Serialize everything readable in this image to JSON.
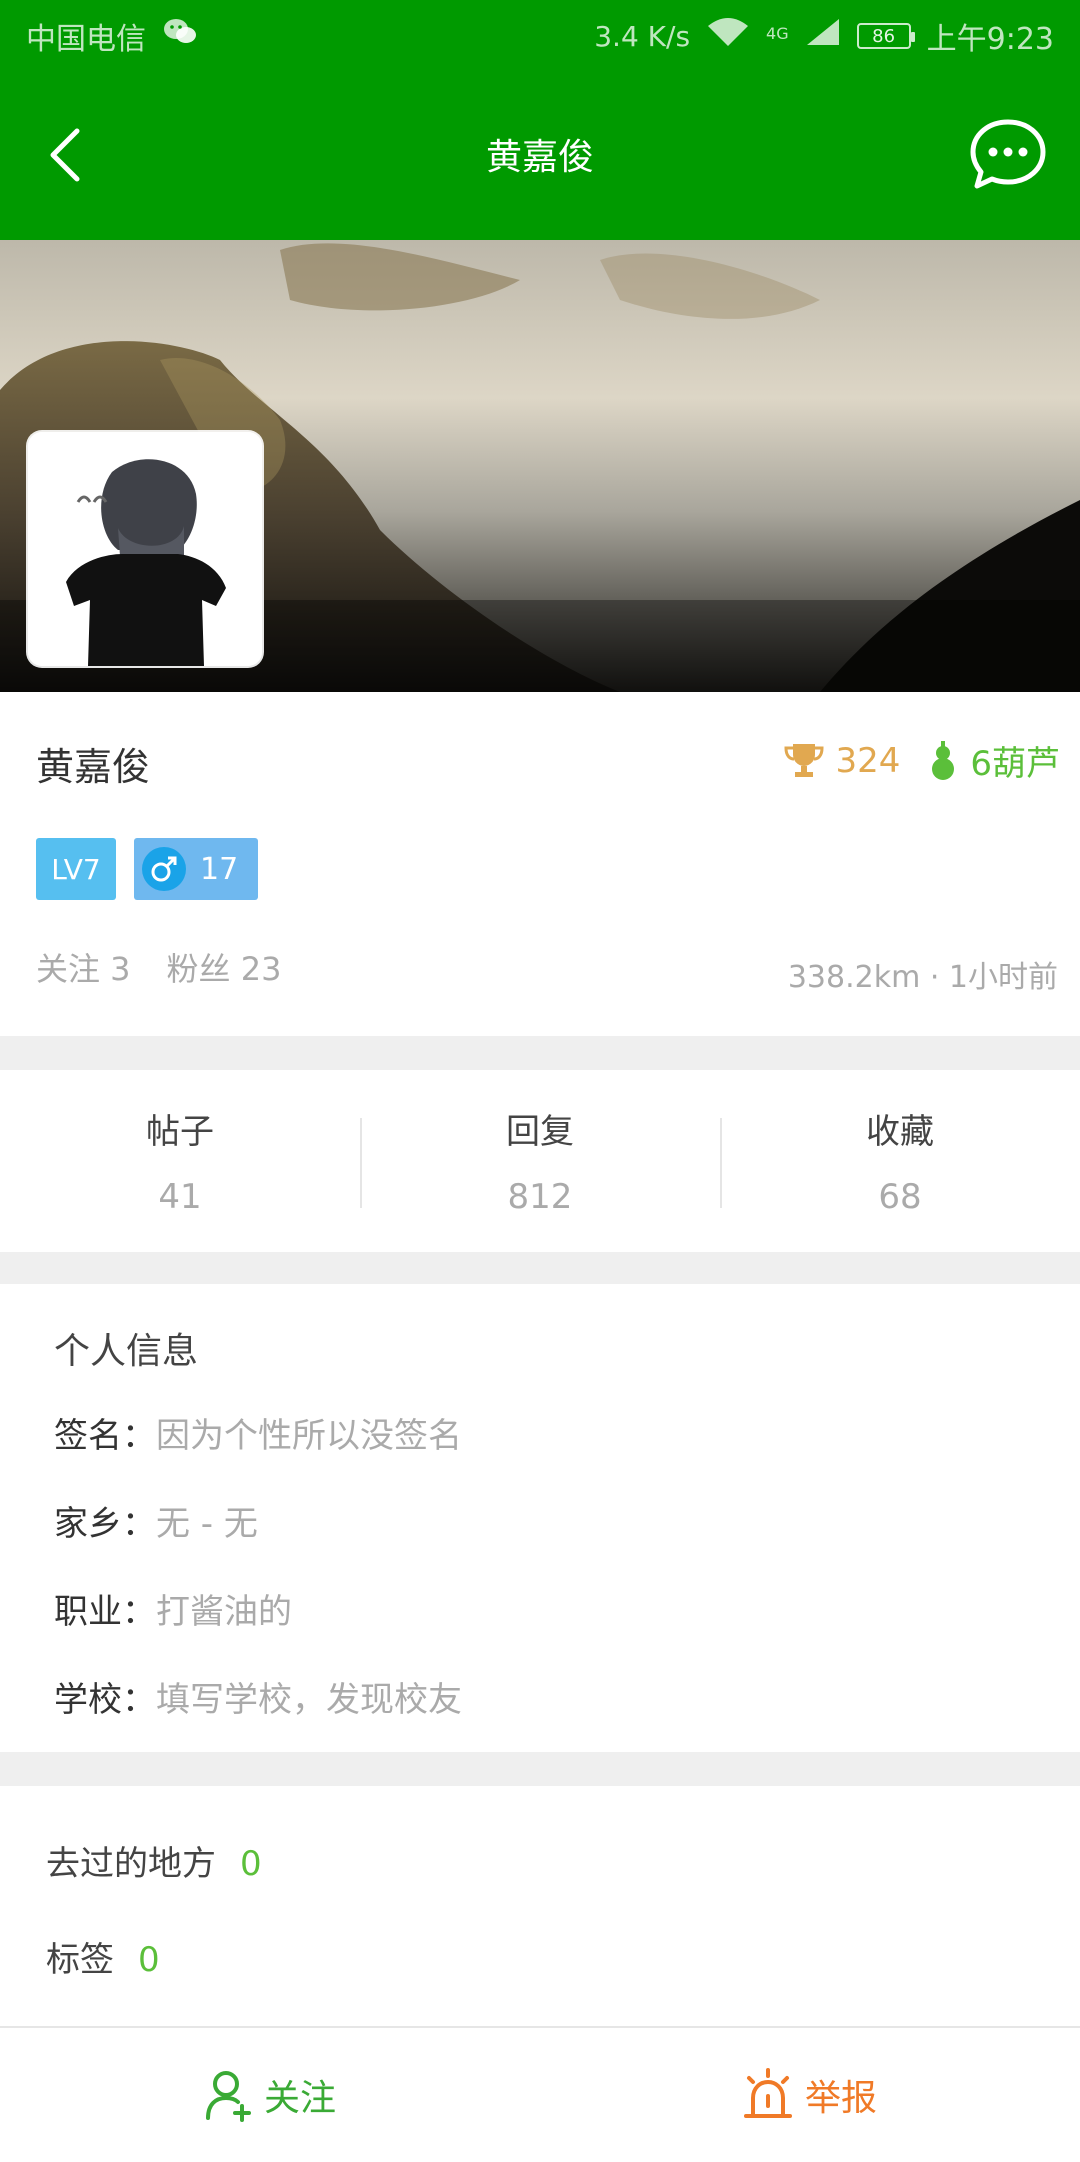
{
  "status_bar": {
    "carrier": "中国电信",
    "speed": "3.4 K/s",
    "network": "4G",
    "battery": "86",
    "time": "上午9:23"
  },
  "app_bar": {
    "title": "黄嘉俊",
    "back_icon": "chevron-left-icon",
    "message_icon": "chat-bubble-icon"
  },
  "profile": {
    "name": "黄嘉俊",
    "trophy_count": "324",
    "gourd_count": "6葫芦",
    "level": "LV7",
    "gender_age": "17",
    "follows": "关注 3",
    "fans": "粉丝 23",
    "distance_time": "338.2km · 1小时前"
  },
  "stats": [
    {
      "label": "帖子",
      "value": "41"
    },
    {
      "label": "回复",
      "value": "812"
    },
    {
      "label": "收藏",
      "value": "68"
    }
  ],
  "personal_info": {
    "title": "个人信息",
    "rows": [
      {
        "label": "签名：",
        "value": "因为个性所以没签名"
      },
      {
        "label": "家乡：",
        "value": "无 - 无"
      },
      {
        "label": "职业：",
        "value": "打酱油的"
      },
      {
        "label": "学校：",
        "value": "填写学校，发现校友"
      }
    ]
  },
  "extras": {
    "places_label": "去过的地方",
    "places_count": "0",
    "tags_label": "标签",
    "tags_count": "0"
  },
  "bottom_bar": {
    "follow_label": "关注",
    "report_label": "举报"
  },
  "colors": {
    "brand_green": "#009a00",
    "trophy_gold": "#e1a850",
    "accent_green": "#5bbf3a",
    "report_orange": "#f07a27",
    "level_blue": "#56bff0"
  }
}
